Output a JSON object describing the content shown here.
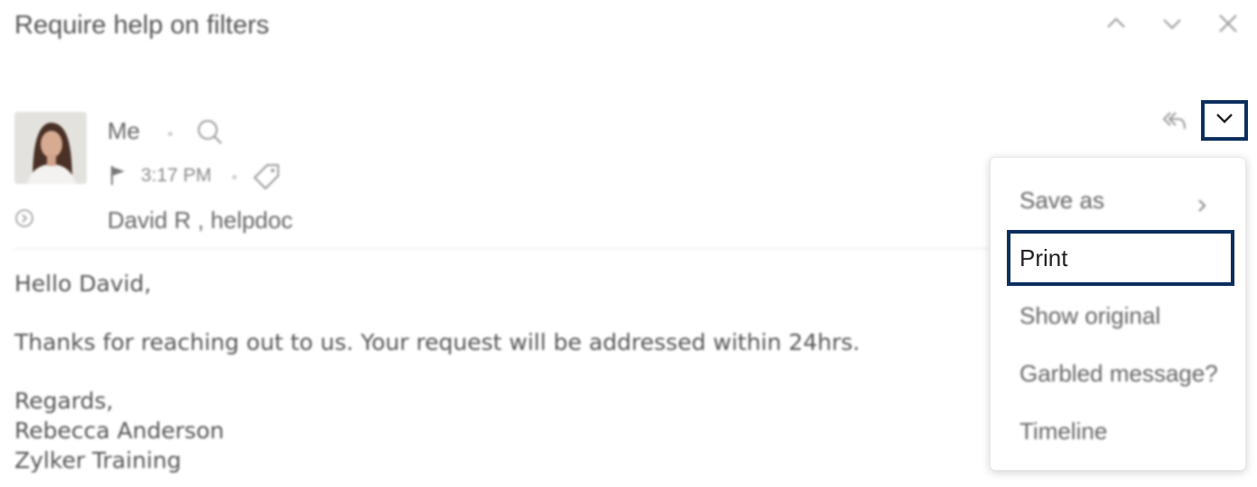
{
  "subject": "Require help on filters",
  "header_icons": [
    "chevron-up-icon",
    "chevron-down-icon",
    "close-icon"
  ],
  "sender": {
    "name": "Me",
    "time": "3:17 PM",
    "recipients": "David R , helpdoc"
  },
  "message": {
    "greeting": "Hello David,",
    "body": "Thanks for reaching out to us. Your request will be addressed within 24hrs.",
    "signoff": "Regards,",
    "signature_name": "Rebecca Anderson",
    "signature_org": "Zylker Training"
  },
  "menu": {
    "items": [
      "Save as",
      "Print",
      "Show original",
      "Garbled message?",
      "Timeline"
    ],
    "highlighted": "Print"
  },
  "colors": {
    "highlight_border": "#0c2f5f",
    "text": "#555555"
  }
}
